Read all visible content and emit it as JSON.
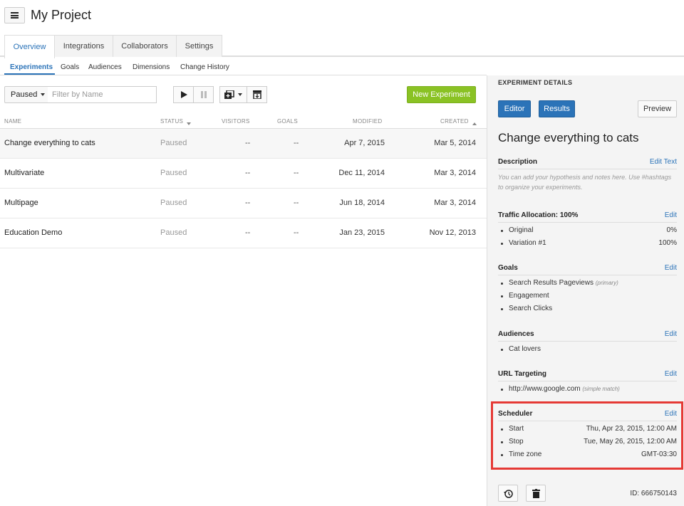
{
  "header": {
    "title": "My Project",
    "menu_icon": "hamburger-icon"
  },
  "main_tabs": [
    {
      "label": "Overview",
      "active": true
    },
    {
      "label": "Integrations"
    },
    {
      "label": "Collaborators"
    },
    {
      "label": "Settings"
    }
  ],
  "sub_tabs": [
    {
      "label": "Experiments",
      "active": true
    },
    {
      "label": "Goals"
    },
    {
      "label": "Audiences"
    },
    {
      "label": "Dimensions"
    },
    {
      "label": "Change History"
    }
  ],
  "toolbar": {
    "status_filter": "Paused",
    "filter_placeholder": "Filter by Name",
    "new_experiment_label": "New Experiment"
  },
  "table": {
    "columns": {
      "name": "NAME",
      "status": "STATUS",
      "visitors": "VISITORS",
      "goals": "GOALS",
      "modified": "MODIFIED",
      "created": "CREATED"
    },
    "rows": [
      {
        "name": "Change everything to cats",
        "status": "Paused",
        "visitors": "--",
        "goals": "--",
        "modified": "Apr 7, 2015",
        "created": "Mar 5, 2014"
      },
      {
        "name": "Multivariate",
        "status": "Paused",
        "visitors": "--",
        "goals": "--",
        "modified": "Dec 11, 2014",
        "created": "Mar 3, 2014"
      },
      {
        "name": "Multipage",
        "status": "Paused",
        "visitors": "--",
        "goals": "--",
        "modified": "Jun 18, 2014",
        "created": "Mar 3, 2014"
      },
      {
        "name": "Education Demo",
        "status": "Paused",
        "visitors": "--",
        "goals": "--",
        "modified": "Jan 23, 2015",
        "created": "Nov 12, 2013"
      }
    ]
  },
  "details": {
    "header": "EXPERIMENT DETAILS",
    "editor_label": "Editor",
    "results_label": "Results",
    "preview_label": "Preview",
    "title": "Change everything to cats",
    "description": {
      "label": "Description",
      "edit": "Edit Text",
      "text": "You can add your hypothesis and notes here. Use #hashtags to organize your experiments."
    },
    "traffic": {
      "label": "Traffic Allocation: 100%",
      "edit": "Edit",
      "items": [
        {
          "name": "Original",
          "value": "0%"
        },
        {
          "name": "Variation #1",
          "value": "100%"
        }
      ]
    },
    "goals": {
      "label": "Goals",
      "edit": "Edit",
      "items": [
        {
          "name": "Search Results Pageviews",
          "note": "(primary)"
        },
        {
          "name": "Engagement"
        },
        {
          "name": "Search Clicks"
        }
      ]
    },
    "audiences": {
      "label": "Audiences",
      "edit": "Edit",
      "items": [
        {
          "name": "Cat lovers"
        }
      ]
    },
    "url_targeting": {
      "label": "URL Targeting",
      "edit": "Edit",
      "items": [
        {
          "name": "http://www.google.com",
          "note": "(simple match)"
        }
      ]
    },
    "scheduler": {
      "label": "Scheduler",
      "edit": "Edit",
      "items": [
        {
          "name": "Start",
          "value": "Thu, Apr 23, 2015, 12:00 AM"
        },
        {
          "name": "Stop",
          "value": "Tue, May 26, 2015, 12:00 AM"
        },
        {
          "name": "Time zone",
          "value": "GMT-03:30"
        }
      ]
    },
    "id_text": "ID: 666750143"
  },
  "colors": {
    "accent": "#2b73b8",
    "new_button": "#8ac224",
    "highlight": "#e53935"
  }
}
